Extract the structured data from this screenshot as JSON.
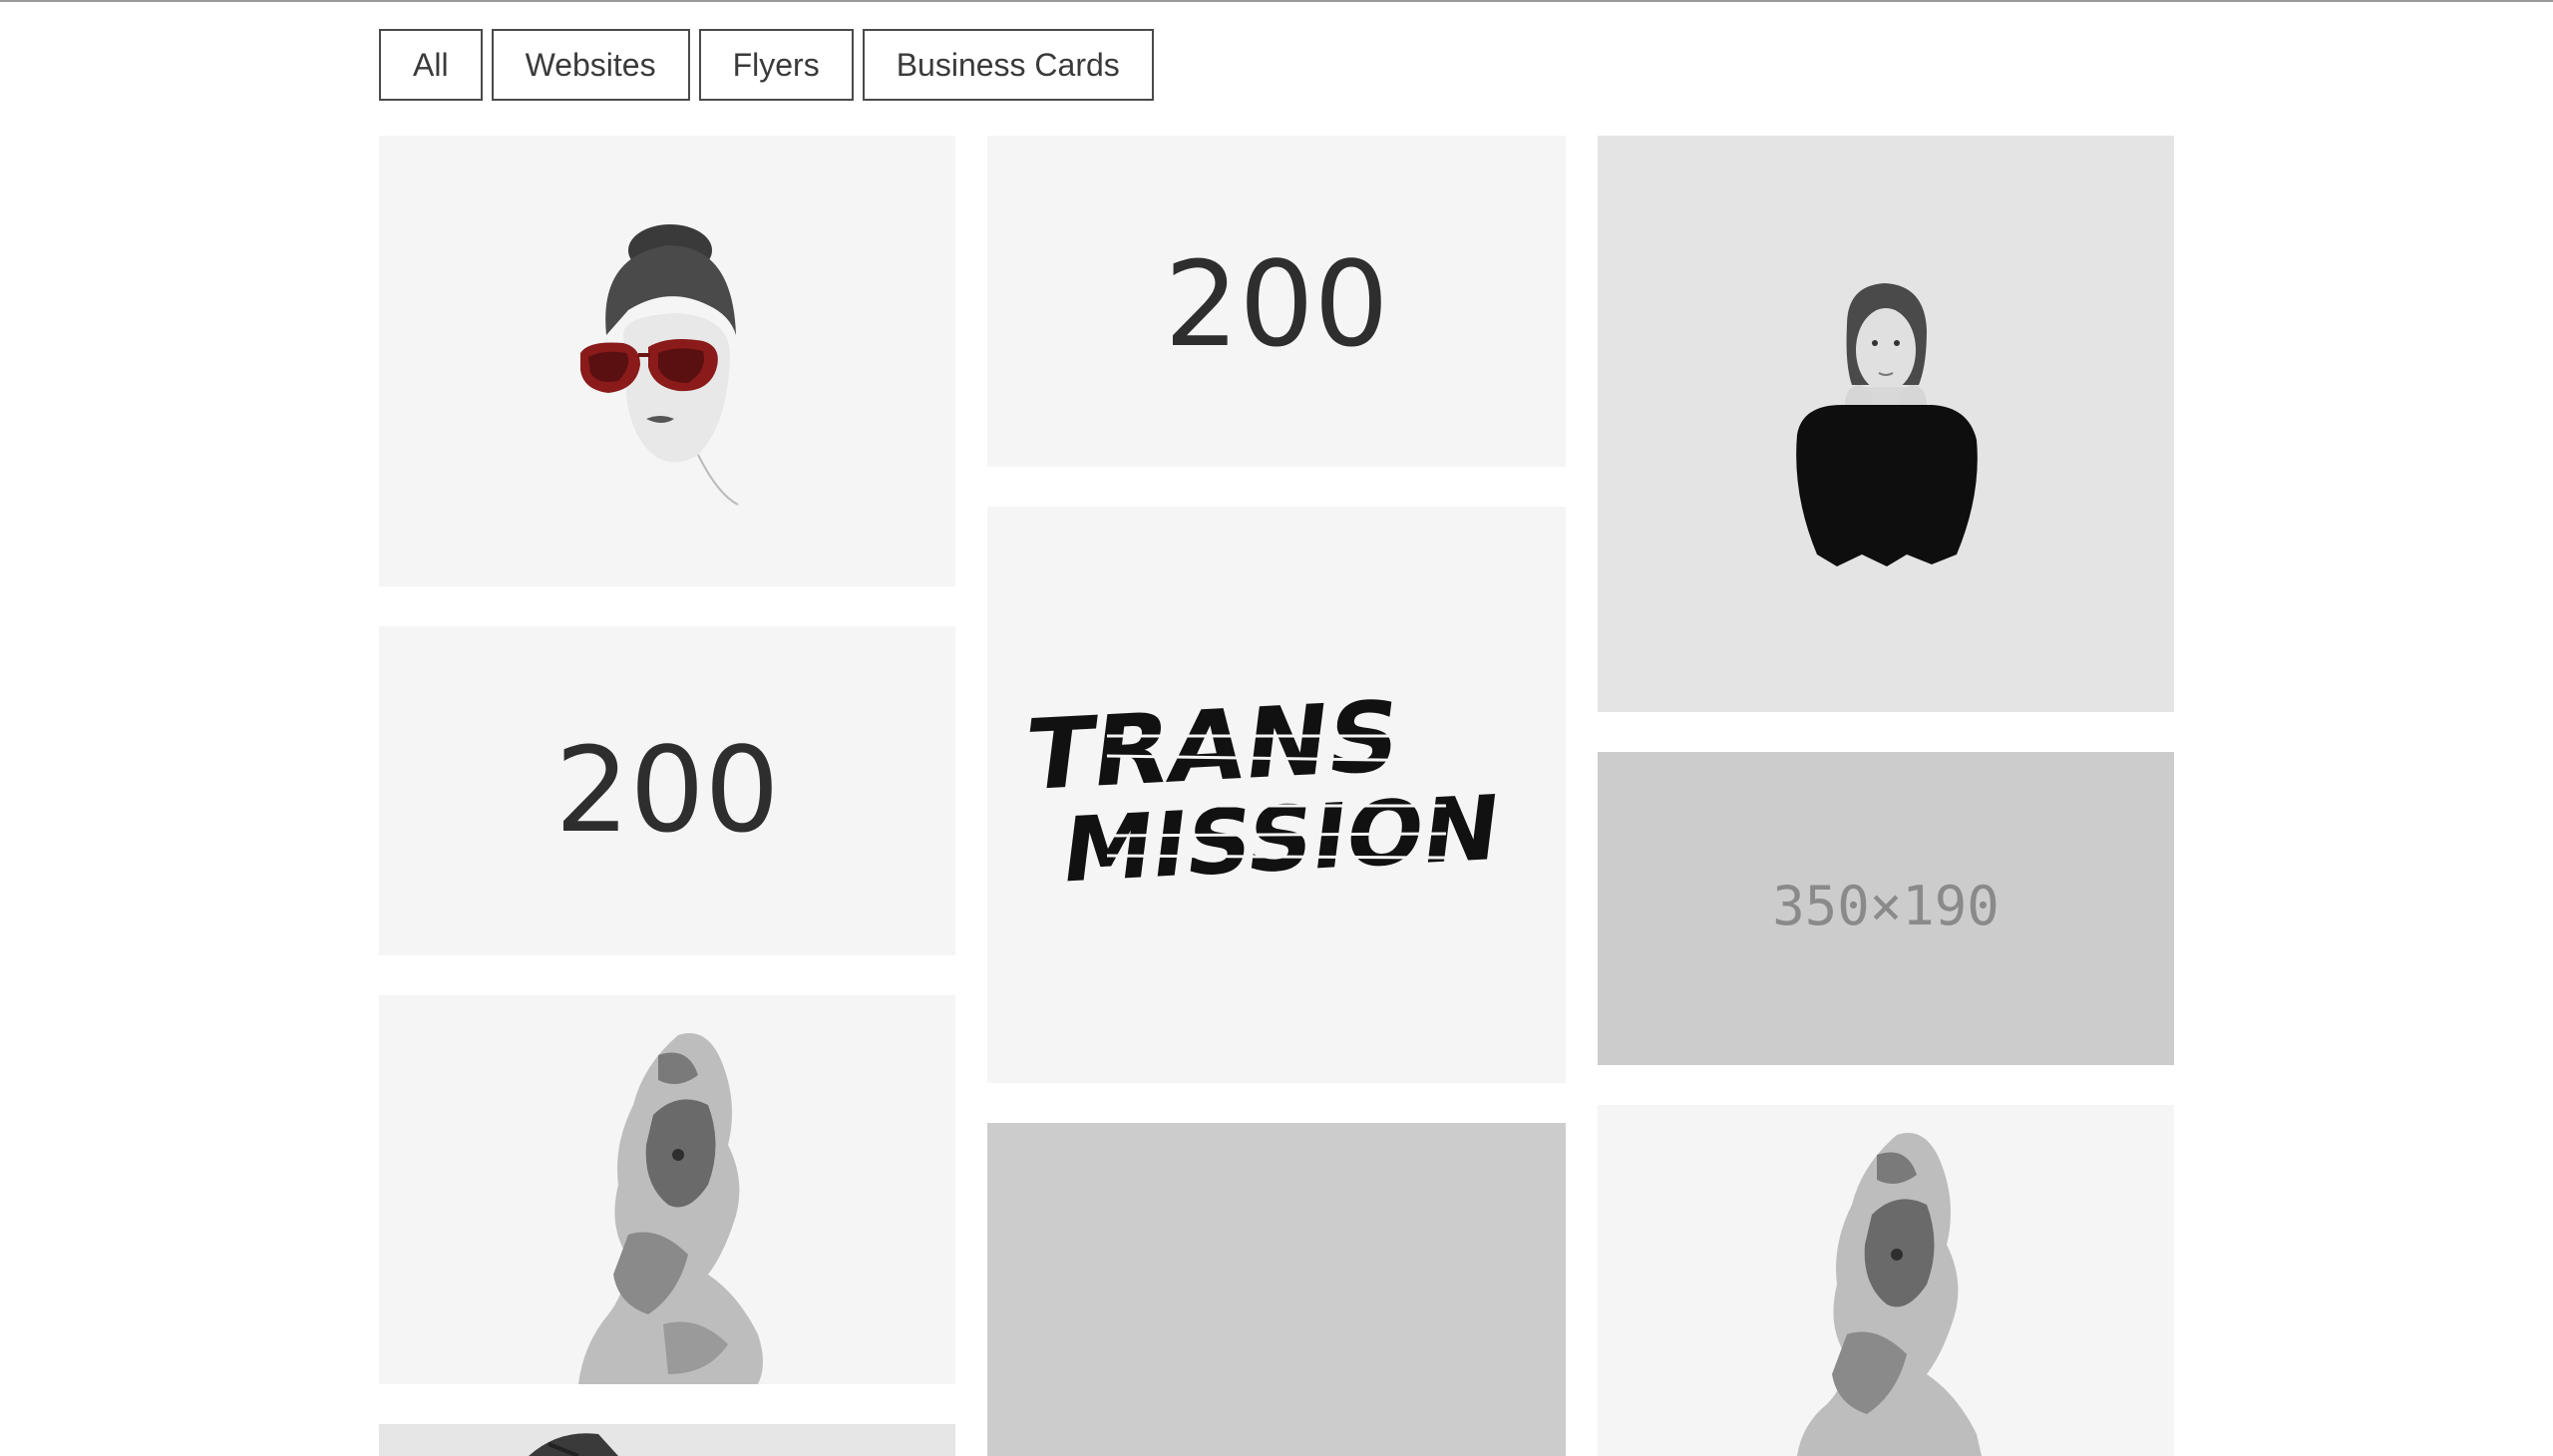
{
  "filters": [
    {
      "label": "All"
    },
    {
      "label": "Websites"
    },
    {
      "label": "Flyers"
    },
    {
      "label": "Business Cards"
    }
  ],
  "portfolio": {
    "tile_200_text": "200",
    "tile_transmission_top": "TRANS",
    "tile_transmission_bottom": "MISSION",
    "placeholder_text": "350×190"
  },
  "colors": {
    "tile_light": "#f5f5f5",
    "tile_grey": "#e4e4e4",
    "placeholder_grey": "#cccccc",
    "placeholder_text": "#8a8a8a",
    "glasses_red": "#8b1a1a"
  }
}
